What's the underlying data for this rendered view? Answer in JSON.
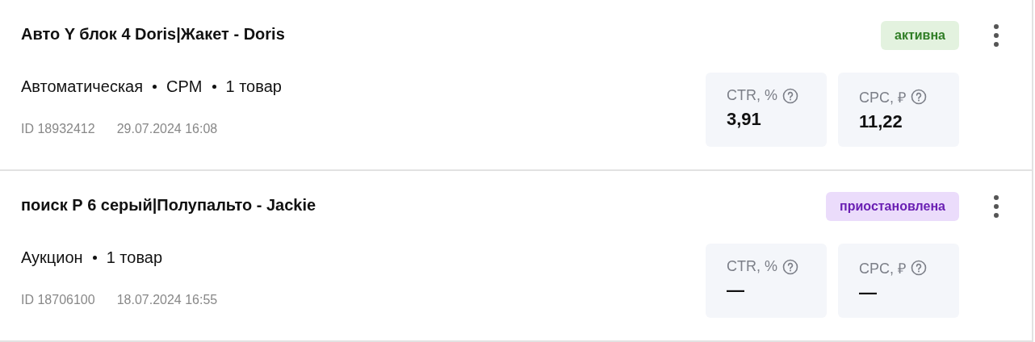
{
  "campaigns": [
    {
      "title": "Авто Y блок 4 Doris|Жакет - Doris",
      "status": {
        "label": "активна",
        "kind": "active"
      },
      "meta": [
        "Автоматическая",
        "CPM",
        "1 товар"
      ],
      "id": "ID 18932412",
      "date": "29.07.2024 16:08",
      "metrics": [
        {
          "label": "CTR, %",
          "value": "3,91"
        },
        {
          "label": "CPC, ₽",
          "value": "11,22"
        }
      ]
    },
    {
      "title": "поиск Р 6 серый|Полупальто - Jackie",
      "status": {
        "label": "приостановлена",
        "kind": "paused"
      },
      "meta": [
        "Аукцион",
        "1 товар"
      ],
      "id": "ID 18706100",
      "date": "18.07.2024 16:55",
      "metrics": [
        {
          "label": "CTR, %",
          "value": "—"
        },
        {
          "label": "CPC, ₽",
          "value": "—"
        }
      ]
    }
  ]
}
